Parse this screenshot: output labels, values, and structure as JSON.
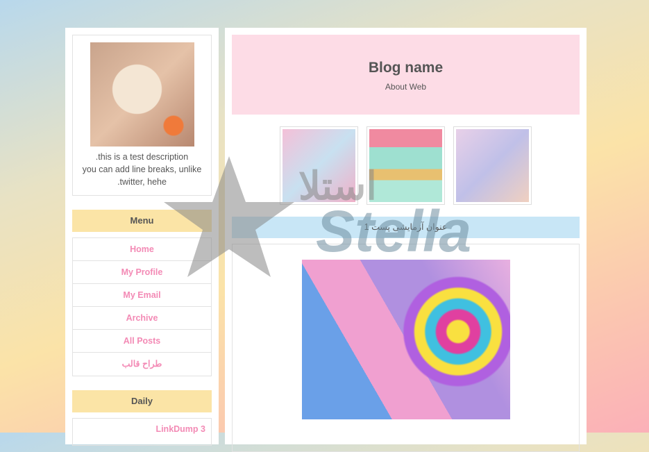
{
  "profile": {
    "description": [
      ".this is a test description",
      "you can add line breaks, unlike",
      ".twitter, hehe"
    ]
  },
  "menu": {
    "title": "Menu",
    "items": [
      "Home",
      "My Profile",
      "My Email",
      "Archive",
      "All Posts",
      "طراح قالب"
    ]
  },
  "daily": {
    "title": "Daily",
    "items": [
      "LinkDump 3"
    ]
  },
  "header": {
    "title": "Blog name",
    "subtitle": "About Web"
  },
  "post": {
    "title": "عنوان آزمایشی پست 1"
  },
  "watermark": {
    "arabic": "استلا",
    "latin": "Stella"
  },
  "colors": {
    "accent": "#f38ab5",
    "menu_header": "#fbe4a6",
    "blog_header": "#fddce6",
    "post_header": "#c8e6f6"
  }
}
